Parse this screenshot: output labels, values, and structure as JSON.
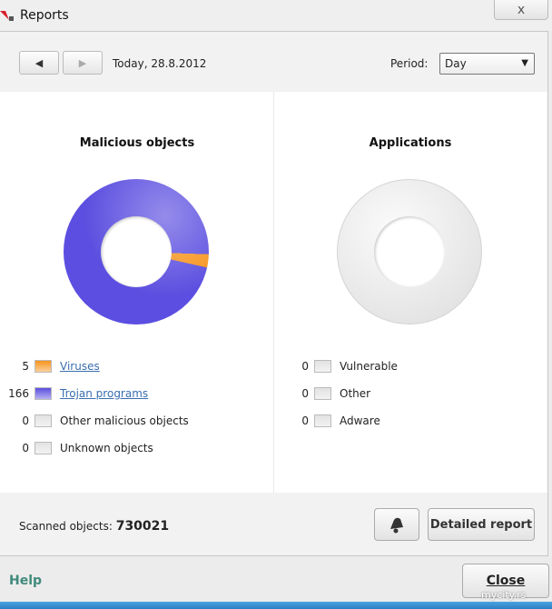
{
  "window": {
    "title": "Reports",
    "close_glyph": "x"
  },
  "toolbar": {
    "prev_icon": "◀",
    "next_icon": "▶",
    "date": "Today, 28.8.2012",
    "period_label": "Period:",
    "period_value": "Day",
    "dropdown_arrow": "▼"
  },
  "malicious": {
    "title": "Malicious objects",
    "items": [
      {
        "count": "5",
        "label": "Viruses",
        "color": "#f7941d",
        "link": true
      },
      {
        "count": "166",
        "label": "Trojan programs",
        "color": "#5b4ee0",
        "link": true
      },
      {
        "count": "0",
        "label": "Other malicious objects",
        "color": "#e2e2e2",
        "link": false
      },
      {
        "count": "0",
        "label": "Unknown objects",
        "color": "#e2e2e2",
        "link": false
      }
    ]
  },
  "applications": {
    "title": "Applications",
    "items": [
      {
        "count": "0",
        "label": "Vulnerable"
      },
      {
        "count": "0",
        "label": "Other"
      },
      {
        "count": "0",
        "label": "Adware"
      }
    ]
  },
  "chart_data": [
    {
      "type": "pie",
      "title": "Malicious objects",
      "categories": [
        "Viruses",
        "Trojan programs",
        "Other malicious objects",
        "Unknown objects"
      ],
      "values": [
        5,
        166,
        0,
        0
      ]
    },
    {
      "type": "pie",
      "title": "Applications",
      "categories": [
        "Vulnerable",
        "Other",
        "Adware"
      ],
      "values": [
        0,
        0,
        0
      ]
    }
  ],
  "bottom": {
    "scanned_label": "Scanned objects:",
    "scanned_value": "730021",
    "detailed_report": "Detailed report",
    "bell_icon": "bell-icon"
  },
  "footer": {
    "help": "Help",
    "close": "Close",
    "watermark": "mycity.rs"
  }
}
